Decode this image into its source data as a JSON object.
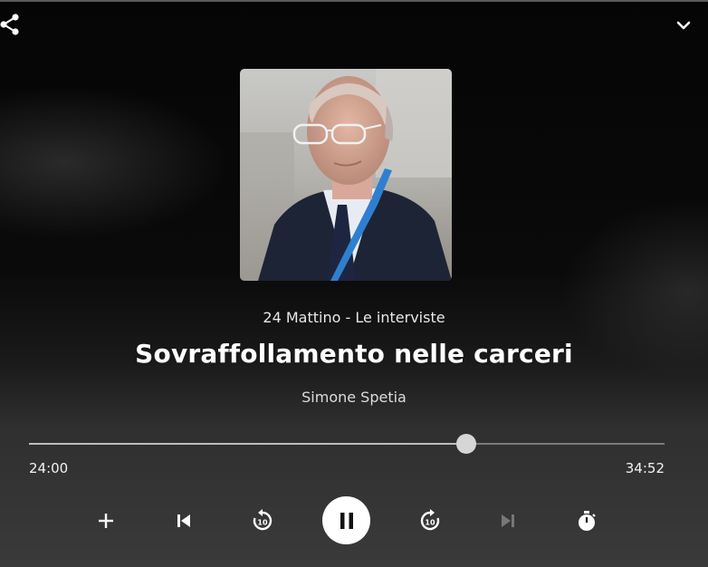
{
  "player": {
    "show_title": "24 Mattino - Le interviste",
    "episode_title": "Sovraffollamento nelle carceri",
    "author": "Simone Spetia",
    "elapsed": "24:00",
    "total": "34:52",
    "progress_fraction": 0.688
  },
  "icons": {
    "share": "share-icon",
    "collapse": "chevron-down-icon",
    "add": "plus-icon",
    "previous": "skip-previous-icon",
    "rewind": "rewind-10-icon",
    "play_pause": "pause-icon",
    "forward": "forward-10-icon",
    "next": "skip-next-icon",
    "timer": "sleep-timer-icon"
  },
  "colors": {
    "background_top": "#050505",
    "background_bottom": "#3a3a3a",
    "play_button": "#ffffff",
    "disabled_icon": "#777777"
  }
}
